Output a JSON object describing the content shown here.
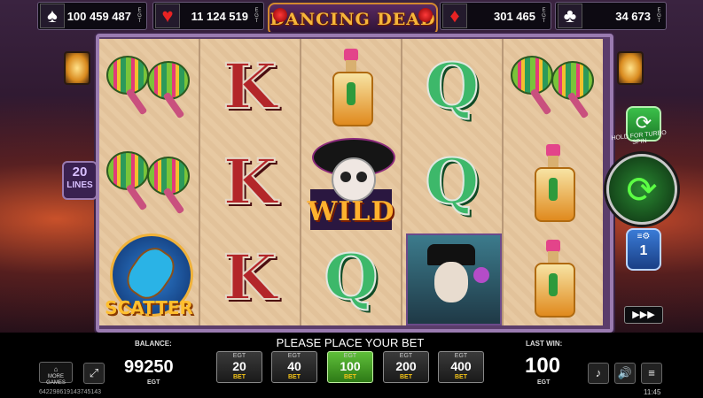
{
  "jackpots": [
    {
      "suit": "spades",
      "glyph": "♠",
      "color": "#ffffff",
      "value": "100 459 487",
      "brand": "EGT"
    },
    {
      "suit": "hearts",
      "glyph": "♥",
      "color": "#e82323",
      "value": "11 124 519",
      "brand": "EGT"
    },
    {
      "suit": "diamonds",
      "glyph": "♦",
      "color": "#e82323",
      "value": "301 465",
      "brand": "EGT"
    },
    {
      "suit": "clubs",
      "glyph": "♣",
      "color": "#ffffff",
      "value": "34 673",
      "brand": "EGT"
    }
  ],
  "game_title": "DANCING DEAD",
  "lines": {
    "count": "20",
    "label": "LINES"
  },
  "reels": [
    [
      "maracas",
      "maracas",
      "scatter"
    ],
    [
      "K",
      "K",
      "K"
    ],
    [
      "tequila",
      "wild",
      "Q"
    ],
    [
      "Q",
      "Q",
      "dancing-man"
    ],
    [
      "maracas",
      "tequila",
      "tequila"
    ]
  ],
  "symbols": {
    "wild_text": "WILD",
    "scatter_text": "SCATTER"
  },
  "right_panel": {
    "turbo_hint": "HOLD FOR TURBO SPIN",
    "autoplay_count": "1",
    "speed_glyph": "▶▶▶",
    "gamble_glyph": "⟳",
    "spin_glyph": "⟳"
  },
  "footer": {
    "more_games": "MORE GAMES",
    "balance_label": "BALANCE:",
    "balance_value": "99250",
    "balance_brand": "EGT",
    "prompt": "PLEASE PLACE YOUR BET",
    "last_win_label": "LAST WIN:",
    "last_win_value": "100",
    "last_win_brand": "EGT",
    "session_id": "642298619143745143",
    "clock": "11:45",
    "bets": [
      {
        "brand": "EGT",
        "value": "20",
        "label": "BET",
        "selected": false
      },
      {
        "brand": "EGT",
        "value": "40",
        "label": "BET",
        "selected": false
      },
      {
        "brand": "EGT",
        "value": "100",
        "label": "BET",
        "selected": true
      },
      {
        "brand": "EGT",
        "value": "200",
        "label": "BET",
        "selected": false
      },
      {
        "brand": "EGT",
        "value": "400",
        "label": "BET",
        "selected": false
      }
    ]
  }
}
